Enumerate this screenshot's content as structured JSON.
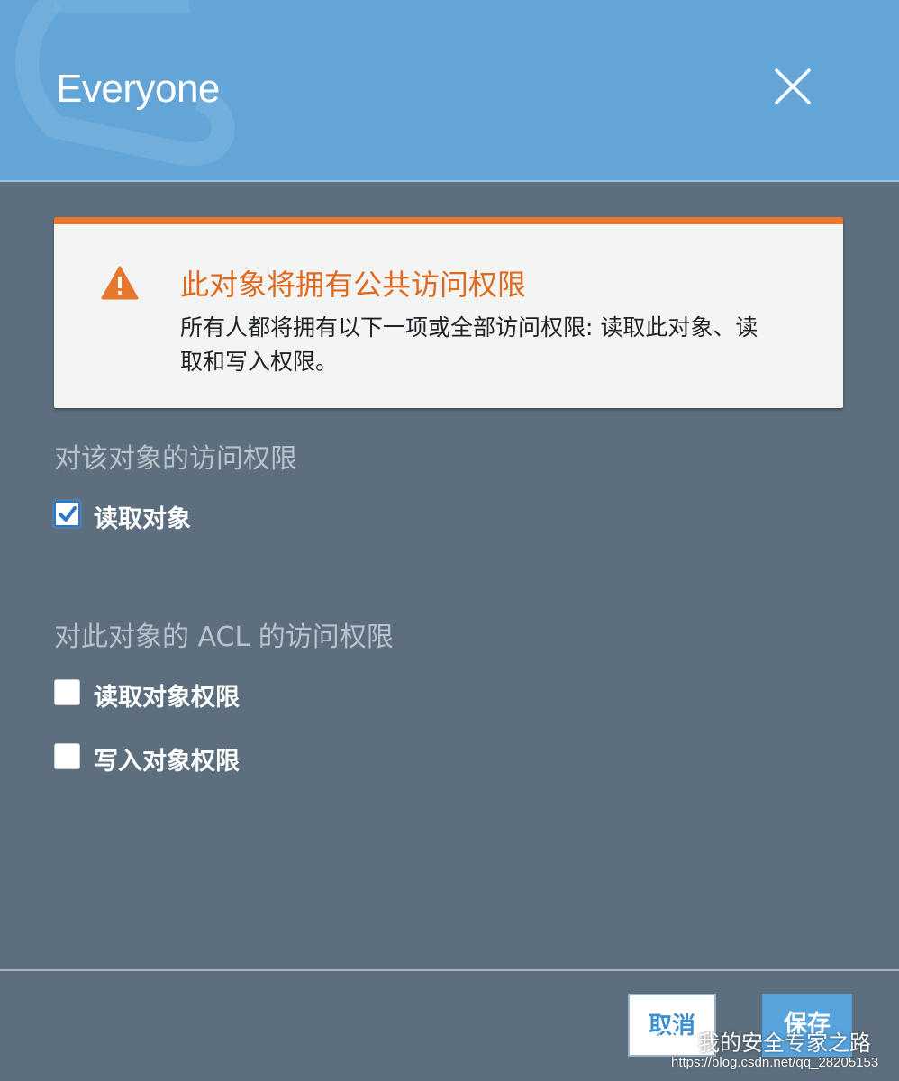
{
  "dialog": {
    "title": "Everyone",
    "close_icon": "close-icon"
  },
  "warning": {
    "icon": "warning-triangle-icon",
    "title": "此对象将拥有公共访问权限",
    "body": "所有人都将拥有以下一项或全部访问权限: 读取此对象、读取和写入权限。",
    "accent_color": "#e8762d"
  },
  "object_access": {
    "heading": "对该对象的访问权限",
    "options": [
      {
        "label": "读取对象",
        "checked": true
      }
    ]
  },
  "acl_access": {
    "heading": "对此对象的 ACL 的访问权限",
    "options": [
      {
        "label": "读取对象权限",
        "checked": false
      },
      {
        "label": "写入对象权限",
        "checked": false
      }
    ]
  },
  "footer": {
    "cancel_label": "取消",
    "save_label": "保存"
  },
  "watermark": {
    "text": "我的安全专家之路",
    "url": "https://blog.csdn.net/qq_28205153"
  },
  "colors": {
    "header_bg": "#63a5d6",
    "body_bg": "#5d6f7e",
    "primary": "#58a3dc"
  }
}
